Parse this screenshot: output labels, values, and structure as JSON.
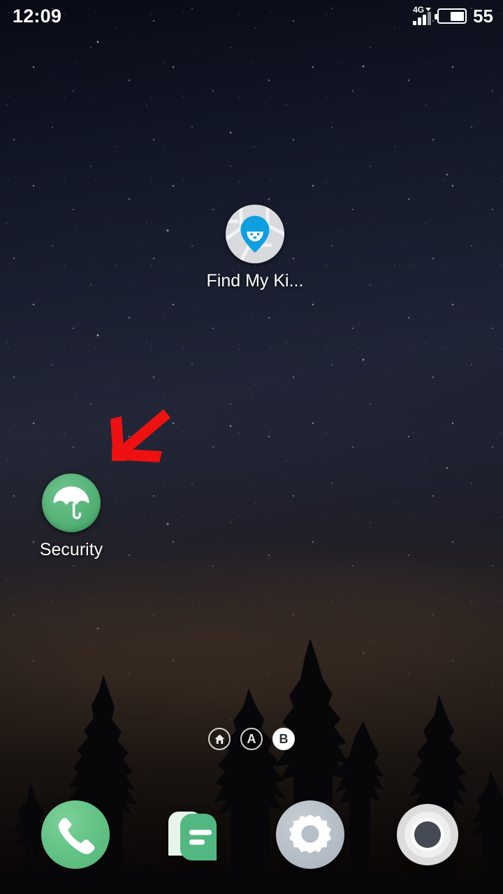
{
  "status_bar": {
    "clock": "12:09",
    "network_type": "4G",
    "battery_percent": "55",
    "battery_level": 55,
    "signal_bars": 4,
    "signal_bars_active": 3
  },
  "home_screen": {
    "apps": [
      {
        "id": "find-my-kids",
        "label": "Find My Ki...",
        "icon": "map-pin-child-icon",
        "icon_colors": {
          "background": "#d9dade",
          "accent": "#0e9fe0"
        }
      },
      {
        "id": "security",
        "label": "Security",
        "icon": "umbrella-icon",
        "icon_colors": {
          "background": "#55b377",
          "accent": "#ffffff"
        }
      }
    ],
    "annotation": {
      "type": "arrow",
      "direction": "down-left",
      "color": "#ee1111",
      "points_to": "security"
    },
    "page_indicators": [
      {
        "id": "home",
        "label": "",
        "icon": "home-icon",
        "active": false
      },
      {
        "id": "page-a",
        "label": "A",
        "icon": "",
        "active": false
      },
      {
        "id": "page-b",
        "label": "B",
        "icon": "",
        "active": true
      }
    ]
  },
  "dock": {
    "items": [
      {
        "id": "phone",
        "icon": "phone-icon",
        "color": "#63c286"
      },
      {
        "id": "messages",
        "icon": "messages-icon",
        "color": "#52b780"
      },
      {
        "id": "settings",
        "icon": "gear-icon",
        "color": "#b6bec7"
      },
      {
        "id": "camera",
        "icon": "camera-icon",
        "color": "#e8e8e8"
      }
    ]
  },
  "wallpaper": {
    "description": "night sky with stars over pine tree silhouettes",
    "sky_color": "#0a0e1b",
    "horizon_color": "#8a6246"
  }
}
